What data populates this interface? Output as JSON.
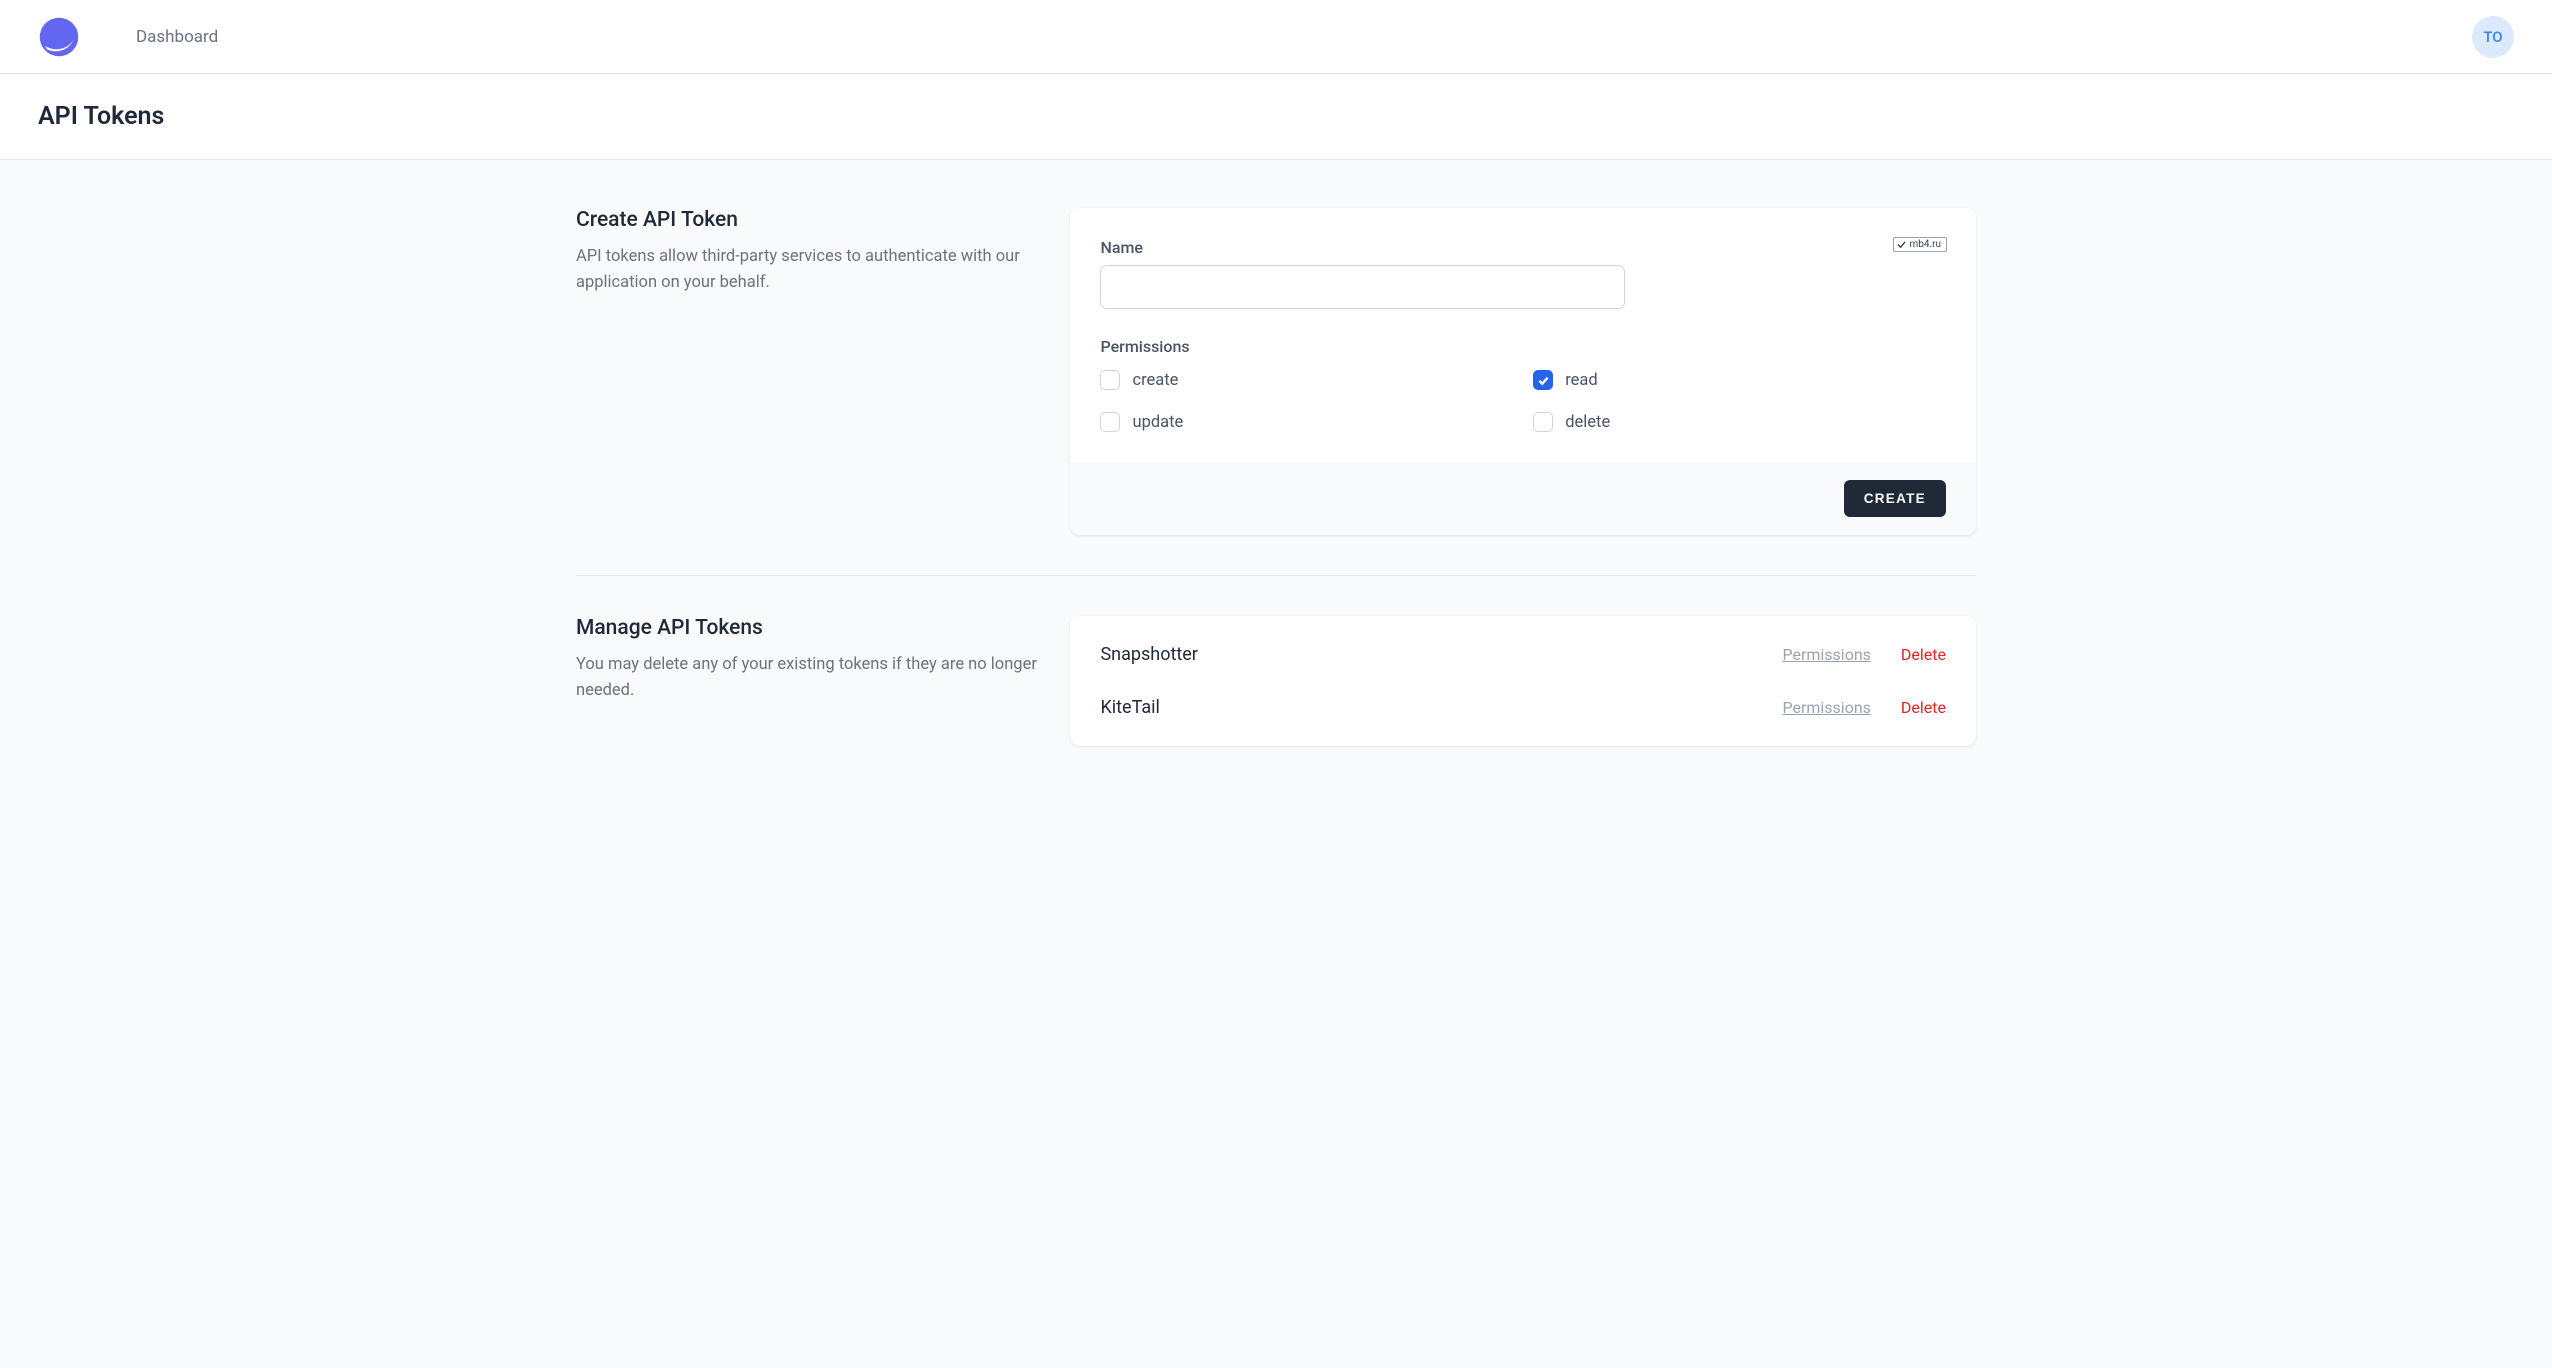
{
  "nav": {
    "dashboard_label": "Dashboard",
    "avatar_initials": "TO"
  },
  "page": {
    "title": "API Tokens"
  },
  "create": {
    "heading": "Create API Token",
    "description": "API tokens allow third-party services to authenticate with our application on your behalf.",
    "name_label": "Name",
    "name_value": "",
    "permissions_label": "Permissions",
    "permissions": [
      {
        "key": "create",
        "label": "create",
        "checked": false
      },
      {
        "key": "read",
        "label": "read",
        "checked": true
      },
      {
        "key": "update",
        "label": "update",
        "checked": false
      },
      {
        "key": "delete",
        "label": "delete",
        "checked": false
      }
    ],
    "submit_label": "CREATE"
  },
  "manage": {
    "heading": "Manage API Tokens",
    "description": "You may delete any of your existing tokens if they are no longer needed.",
    "tokens": [
      {
        "name": "Snapshotter"
      },
      {
        "name": "KiteTail"
      }
    ],
    "permissions_action_label": "Permissions",
    "delete_action_label": "Delete"
  },
  "watermark": {
    "text": "mb4.ru"
  }
}
